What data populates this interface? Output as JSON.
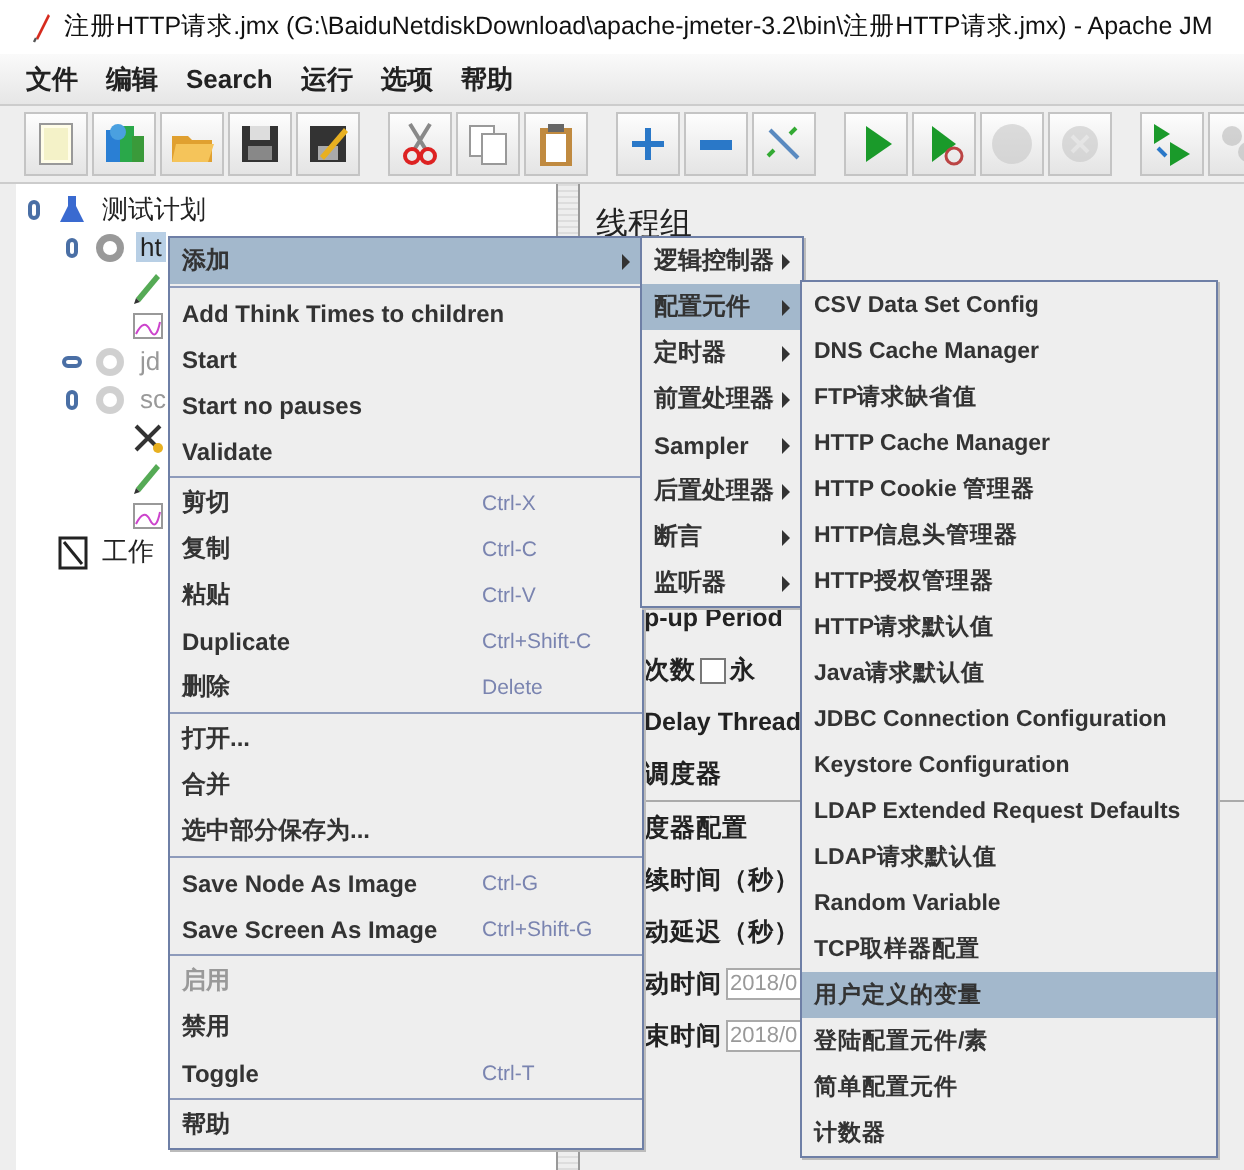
{
  "window": {
    "title": "注册HTTP请求.jmx (G:\\BaiduNetdiskDownload\\apache-jmeter-3.2\\bin\\注册HTTP请求.jmx) - Apache JM"
  },
  "menu_bar": [
    "文件",
    "编辑",
    "Search",
    "运行",
    "选项",
    "帮助"
  ],
  "toolbar": [
    {
      "disabled": false
    },
    {
      "disabled": false
    },
    {
      "disabled": false
    },
    {
      "disabled": false
    },
    {
      "disabled": false
    },
    {
      "disabled": false
    },
    {
      "disabled": false
    },
    {
      "disabled": false
    },
    {
      "disabled": false
    },
    {
      "disabled": false
    },
    {
      "disabled": false
    },
    {
      "disabled": false
    },
    {
      "disabled": false
    },
    {
      "disabled": true
    },
    {
      "disabled": true
    },
    {
      "disabled": false
    },
    {
      "disabled": true
    }
  ],
  "tree": [
    {
      "kind": "plan",
      "label": "测试计划",
      "expanded": true,
      "selected": false,
      "disabled": false,
      "children": [
        {
          "kind": "group",
          "label": "ht",
          "expanded": true,
          "selected": true,
          "disabled": false,
          "children": [
            {
              "kind": "sampler",
              "selected": false,
              "disabled": false
            },
            {
              "kind": "listener",
              "selected": false,
              "disabled": false
            }
          ]
        },
        {
          "kind": "group",
          "label": "jd",
          "expanded": false,
          "selected": false,
          "disabled": true
        },
        {
          "kind": "group",
          "label": "sc",
          "expanded": true,
          "selected": false,
          "disabled": true,
          "children": [
            {
              "kind": "tool",
              "selected": false,
              "disabled": false
            },
            {
              "kind": "sampler",
              "selected": false,
              "disabled": false
            },
            {
              "kind": "listener",
              "selected": false,
              "disabled": false
            }
          ]
        }
      ]
    },
    {
      "kind": "workbench",
      "label": "工作",
      "selected": false,
      "disabled": false
    }
  ],
  "panel": {
    "title": "线程组",
    "rows": [
      {
        "kind": "label",
        "text": "p-up Period"
      },
      {
        "kind": "checkbox",
        "text": "次数",
        "checked": false,
        "option": "永"
      },
      {
        "kind": "label",
        "text": "Delay Thread"
      },
      {
        "kind": "label",
        "text": "调度器"
      },
      {
        "kind": "heading",
        "text": "度器配置"
      },
      {
        "kind": "label",
        "text": "续时间（秒）"
      },
      {
        "kind": "label",
        "text": "动延迟（秒）"
      },
      {
        "kind": "field",
        "text": "动时间",
        "value": "2018/0"
      },
      {
        "kind": "field",
        "text": "束时间",
        "value": "2018/0"
      }
    ]
  },
  "context_menu": {
    "items": [
      {
        "kind": "submenu",
        "label": "添加",
        "selected": true
      },
      {
        "kind": "separator"
      },
      {
        "kind": "item",
        "label": "Add Think Times to children",
        "selected": false,
        "disabled": false
      },
      {
        "kind": "item",
        "label": "Start",
        "selected": false,
        "disabled": false
      },
      {
        "kind": "item",
        "label": "Start no pauses",
        "selected": false,
        "disabled": false
      },
      {
        "kind": "item",
        "label": "Validate",
        "selected": false,
        "disabled": false
      },
      {
        "kind": "separator"
      },
      {
        "kind": "item",
        "label": "剪切",
        "shortcut": "Ctrl-X",
        "selected": false,
        "disabled": false
      },
      {
        "kind": "item",
        "label": "复制",
        "shortcut": "Ctrl-C",
        "selected": false,
        "disabled": false
      },
      {
        "kind": "item",
        "label": "粘贴",
        "shortcut": "Ctrl-V",
        "selected": false,
        "disabled": false
      },
      {
        "kind": "item",
        "label": "Duplicate",
        "shortcut": "Ctrl+Shift-C",
        "selected": false,
        "disabled": false
      },
      {
        "kind": "item",
        "label": "删除",
        "shortcut": "Delete",
        "selected": false,
        "disabled": false
      },
      {
        "kind": "separator"
      },
      {
        "kind": "item",
        "label": "打开...",
        "selected": false,
        "disabled": false
      },
      {
        "kind": "item",
        "label": "合并",
        "selected": false,
        "disabled": false
      },
      {
        "kind": "item",
        "label": "选中部分保存为...",
        "selected": false,
        "disabled": false
      },
      {
        "kind": "separator"
      },
      {
        "kind": "item",
        "label": "Save Node As Image",
        "shortcut": "Ctrl-G",
        "selected": false,
        "disabled": false
      },
      {
        "kind": "item",
        "label": "Save Screen As Image",
        "shortcut": "Ctrl+Shift-G",
        "selected": false,
        "disabled": false
      },
      {
        "kind": "separator"
      },
      {
        "kind": "item",
        "label": "启用",
        "selected": false,
        "disabled": true
      },
      {
        "kind": "item",
        "label": "禁用",
        "selected": false,
        "disabled": false
      },
      {
        "kind": "item",
        "label": "Toggle",
        "shortcut": "Ctrl-T",
        "selected": false,
        "disabled": false
      },
      {
        "kind": "separator"
      },
      {
        "kind": "item",
        "label": "帮助",
        "selected": false,
        "disabled": false
      }
    ]
  },
  "add_submenu": {
    "items": [
      {
        "kind": "submenu",
        "label": "逻辑控制器",
        "selected": false
      },
      {
        "kind": "submenu",
        "label": "配置元件",
        "selected": true
      },
      {
        "kind": "submenu",
        "label": "定时器",
        "selected": false
      },
      {
        "kind": "submenu",
        "label": "前置处理器",
        "selected": false
      },
      {
        "kind": "submenu",
        "label": "Sampler",
        "selected": false
      },
      {
        "kind": "submenu",
        "label": "后置处理器",
        "selected": false
      },
      {
        "kind": "submenu",
        "label": "断言",
        "selected": false
      },
      {
        "kind": "submenu",
        "label": "监听器",
        "selected": false
      }
    ]
  },
  "config_submenu": {
    "items": [
      {
        "kind": "item",
        "label": "CSV Data Set Config",
        "selected": false,
        "disabled": false
      },
      {
        "kind": "item",
        "label": "DNS Cache Manager",
        "selected": false,
        "disabled": false
      },
      {
        "kind": "item",
        "label": "FTP请求缺省值",
        "selected": false,
        "disabled": false
      },
      {
        "kind": "item",
        "label": "HTTP Cache Manager",
        "selected": false,
        "disabled": false
      },
      {
        "kind": "item",
        "label": "HTTP Cookie 管理器",
        "selected": false,
        "disabled": false
      },
      {
        "kind": "item",
        "label": "HTTP信息头管理器",
        "selected": false,
        "disabled": false
      },
      {
        "kind": "item",
        "label": "HTTP授权管理器",
        "selected": false,
        "disabled": false
      },
      {
        "kind": "item",
        "label": "HTTP请求默认值",
        "selected": false,
        "disabled": false
      },
      {
        "kind": "item",
        "label": "Java请求默认值",
        "selected": false,
        "disabled": false
      },
      {
        "kind": "item",
        "label": "JDBC Connection Configuration",
        "selected": false,
        "disabled": false
      },
      {
        "kind": "item",
        "label": "Keystore Configuration",
        "selected": false,
        "disabled": false
      },
      {
        "kind": "item",
        "label": "LDAP Extended Request Defaults",
        "selected": false,
        "disabled": false
      },
      {
        "kind": "item",
        "label": "LDAP请求默认值",
        "selected": false,
        "disabled": false
      },
      {
        "kind": "item",
        "label": "Random Variable",
        "selected": false,
        "disabled": false
      },
      {
        "kind": "item",
        "label": "TCP取样器配置",
        "selected": false,
        "disabled": false
      },
      {
        "kind": "item",
        "label": "用户定义的变量",
        "selected": true,
        "disabled": false
      },
      {
        "kind": "item",
        "label": "登陆配置元件/素",
        "selected": false,
        "disabled": false
      },
      {
        "kind": "item",
        "label": "简单配置元件",
        "selected": false,
        "disabled": false
      },
      {
        "kind": "item",
        "label": "计数器",
        "selected": false,
        "disabled": false
      }
    ]
  }
}
